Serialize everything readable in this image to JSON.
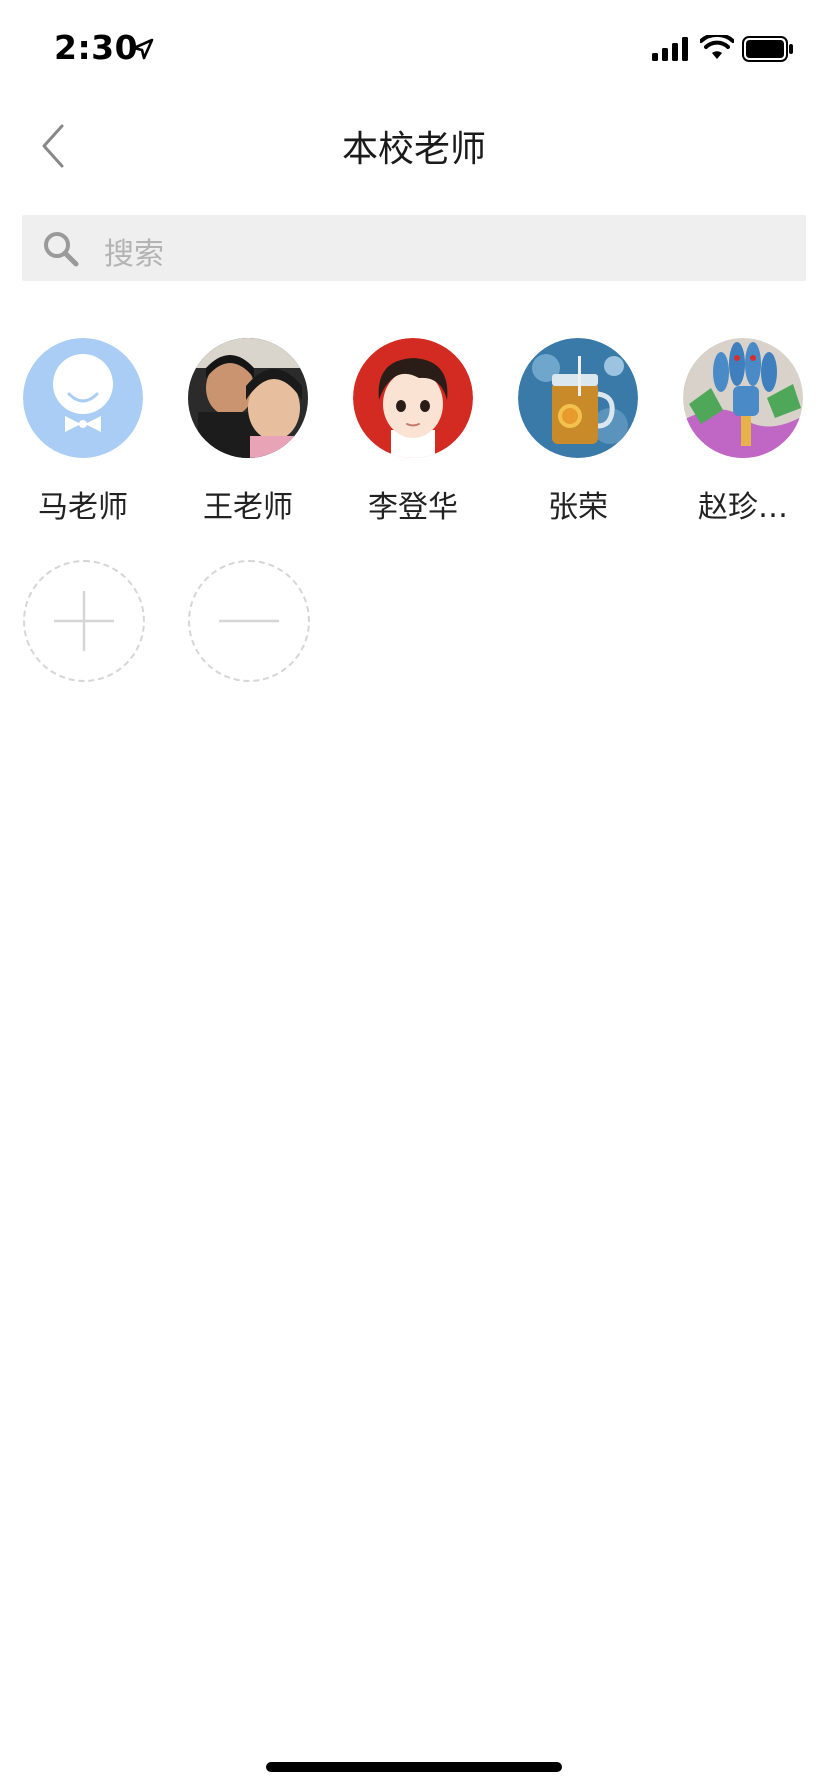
{
  "status_bar": {
    "time": "2:30",
    "icons": [
      "location-arrow-icon",
      "cellular-signal-icon",
      "wifi-icon",
      "battery-icon"
    ]
  },
  "nav": {
    "title": "本校老师",
    "back_icon": "chevron-left-icon"
  },
  "search": {
    "placeholder": "搜索",
    "icon": "search-icon"
  },
  "contacts": [
    {
      "name": "马老师",
      "avatar": "default-avatar-icon",
      "avatar_color": "#a9cdf5"
    },
    {
      "name": "王老师",
      "avatar": "photo-avatar-adult-child"
    },
    {
      "name": "李登华",
      "avatar": "cartoon-boy-avatar",
      "avatar_color": "#d32b22"
    },
    {
      "name": "张荣",
      "avatar": "iced-tea-jar-avatar",
      "avatar_color": "#3a7aa8"
    },
    {
      "name": "赵珍…",
      "avatar": "drawing-artwork-avatar"
    }
  ],
  "actions": {
    "add_icon": "plus-icon",
    "remove_icon": "minus-icon"
  },
  "colors": {
    "search_background": "#efefef",
    "placeholder": "#b3b3b3",
    "dashed_border": "#d6d6d6"
  }
}
